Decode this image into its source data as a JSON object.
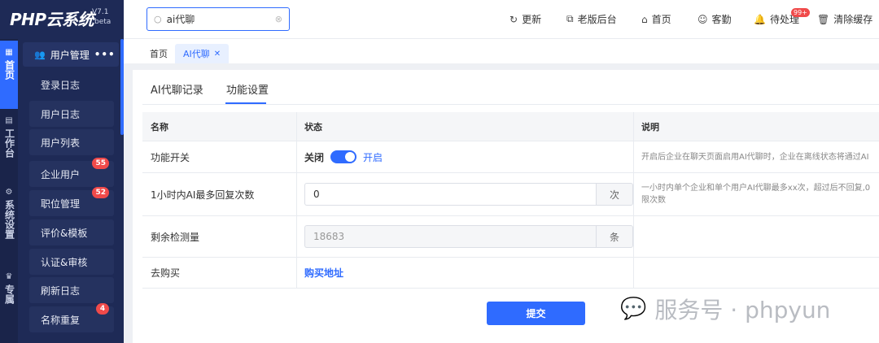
{
  "brand": {
    "logo": "PHP云系统",
    "version": "V7.1",
    "beta": "beta"
  },
  "rail": [
    {
      "icon": "▦",
      "label": "首页",
      "active": true
    },
    {
      "icon": "▤",
      "label": "工作台",
      "active": false
    },
    {
      "icon": "⚙",
      "label": "系统设置",
      "active": false
    },
    {
      "icon": "♛",
      "label": "专属",
      "active": false
    }
  ],
  "sidebar": {
    "header": {
      "label": "用户管理",
      "more": "•••"
    },
    "items": [
      {
        "label": "登录日志",
        "badge": ""
      },
      {
        "label": "用户日志",
        "badge": ""
      },
      {
        "label": "用户列表",
        "badge": ""
      },
      {
        "label": "企业用户",
        "badge": "55"
      },
      {
        "label": "职位管理",
        "badge": "52"
      },
      {
        "label": "评价&模板",
        "badge": ""
      },
      {
        "label": "认证&审核",
        "badge": ""
      },
      {
        "label": "刷新日志",
        "badge": ""
      },
      {
        "label": "名称重复",
        "badge": "4"
      }
    ]
  },
  "search": {
    "value": "ai代聊"
  },
  "topbar": {
    "refresh": "更新",
    "old_backend": "老版后台",
    "home": "首页",
    "attendance": "客勤",
    "pending": "待处理",
    "pending_badge": "99+",
    "clear_cache": "清除缓存"
  },
  "tabs": {
    "home": "首页",
    "current": "AI代聊"
  },
  "subtabs": {
    "records": "AI代聊记录",
    "settings": "功能设置"
  },
  "table": {
    "headers": {
      "name": "名称",
      "status": "状态",
      "desc": "说明"
    },
    "rows": {
      "switch": {
        "name": "功能开关",
        "off": "关闭",
        "on": "开启",
        "desc": "开启后企业在聊天页面启用AI代聊时，企业在离线状态将通过AI"
      },
      "max_replies": {
        "name": "1小时内AI最多回复次数",
        "value": "0",
        "unit": "次",
        "desc": "一小时内单个企业和单个用户AI代聊最多xx次，超过后不回复,0限次数"
      },
      "remaining": {
        "name": "剩余检测量",
        "value": "18683",
        "unit": "条"
      },
      "buy": {
        "name": "去购买",
        "link": "购买地址"
      }
    }
  },
  "submit_label": "提交",
  "watermark": "服务号 · phpyun",
  "colors": {
    "accent": "#2f6bff",
    "sidebar": "#1e2a56",
    "badge": "#f04a4a"
  }
}
